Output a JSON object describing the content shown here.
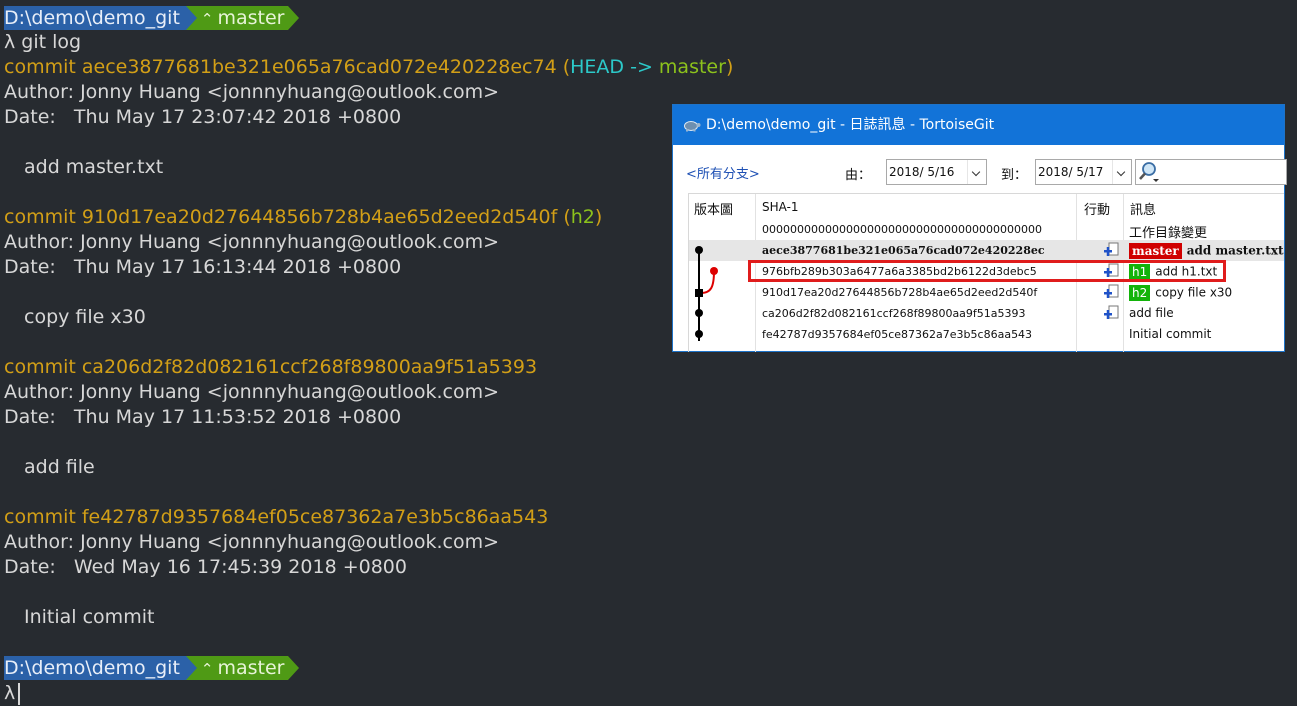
{
  "terminal": {
    "prompt_path": "D:\\demo\\demo_git",
    "prompt_branch": "master",
    "prompt_symbol": "λ",
    "command": "git log",
    "commits": [
      {
        "hash_line": "commit aece3877681be321e065a76cad072e420228ec74",
        "ref_open": " (",
        "ref_head": "HEAD -> ",
        "ref_branch": "master",
        "ref_close": ")",
        "author": "Author: Jonny Huang <jonnnyhuang@outlook.com>",
        "date": "Date:   Thu May 17 23:07:42 2018 +0800",
        "message": "add master.txt"
      },
      {
        "hash_line": "commit 910d17ea20d27644856b728b4ae65d2eed2d540f",
        "ref_open": " (",
        "ref_branch": "h2",
        "ref_close": ")",
        "author": "Author: Jonny Huang <jonnnyhuang@outlook.com>",
        "date": "Date:   Thu May 17 16:13:44 2018 +0800",
        "message": "copy file x30"
      },
      {
        "hash_line": "commit ca206d2f82d082161ccf268f89800aa9f51a5393",
        "author": "Author: Jonny Huang <jonnnyhuang@outlook.com>",
        "date": "Date:   Thu May 17 11:53:52 2018 +0800",
        "message": "add file"
      },
      {
        "hash_line": "commit fe42787d9357684ef05ce87362a7e3b5c86aa543",
        "author": "Author: Jonny Huang <jonnnyhuang@outlook.com>",
        "date": "Date:   Wed May 16 17:45:39 2018 +0800",
        "message": "Initial commit"
      }
    ]
  },
  "tortoise": {
    "title": "D:\\demo\\demo_git - 日誌訊息 - TortoiseGit",
    "branch_link": "<所有分支>",
    "from_label": "由：",
    "from_date": "2018/ 5/16",
    "to_label": "到：",
    "to_date": "2018/ 5/17",
    "headers": {
      "graph": "版本圖",
      "sha": "SHA-1",
      "action": "行動",
      "message": "訊息"
    },
    "rows": [
      {
        "sha": "0000000000000000000000000000000000000000",
        "message": "工作目錄變更"
      },
      {
        "sha": "aece3877681be321e065a76cad072e420228ec",
        "tag": "master",
        "message": "add master.txt"
      },
      {
        "sha": "976bfb289b303a6477a6a3385bd2b6122d3debc5",
        "tag": "h1",
        "message": "add h1.txt"
      },
      {
        "sha": "910d17ea20d27644856b728b4ae65d2eed2d540f",
        "tag": "h2",
        "message": "copy file x30"
      },
      {
        "sha": "ca206d2f82d082161ccf268f89800aa9f51a5393",
        "message": "add file"
      },
      {
        "sha": "fe42787d9357684ef05ce87362a7e3b5c86aa543",
        "message": "Initial commit"
      }
    ]
  },
  "colors": {
    "terminal_bg": "#272b30",
    "commit_yellow": "#d29f17",
    "head_cyan": "#2cc9c9",
    "branch_green": "#8cc21c",
    "prompt_blue": "#2b61a8",
    "prompt_green": "#4f9a15",
    "master_tag_red": "#d00000",
    "branch_tag_green": "#13b30a",
    "highlight_red": "#e01c1c"
  }
}
